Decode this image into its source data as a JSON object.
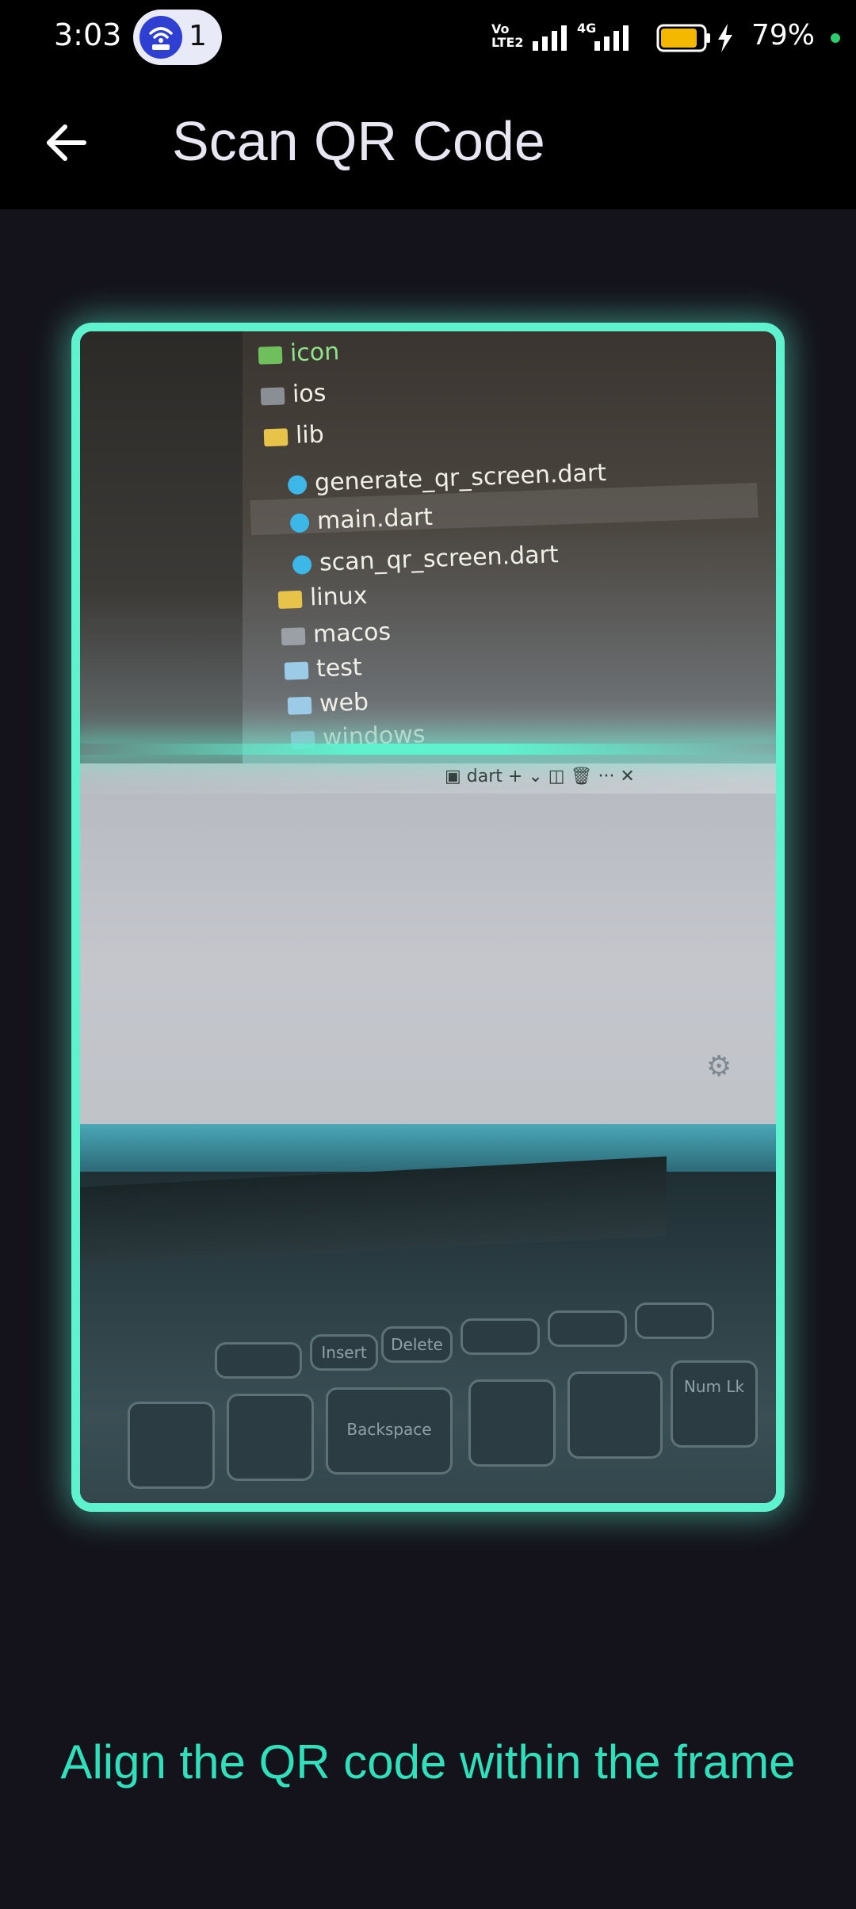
{
  "status_bar": {
    "time": "3:03",
    "notification_count": "1",
    "network_label_top": "Vo",
    "network_label_bottom": "LTE2",
    "network_4g": "4G",
    "battery_percent": "79%"
  },
  "app_bar": {
    "title": "Scan QR Code",
    "back_icon": "arrow-left-icon"
  },
  "camera_preview": {
    "file_tree": [
      "icon",
      "ios",
      "lib",
      "generate_qr_screen.dart",
      "main.dart",
      "scan_qr_screen.dart",
      "linux",
      "macos",
      "test",
      "web",
      "windows"
    ],
    "terminal_label": "dart",
    "key_labels": [
      "Backspace",
      "Num Lk",
      "Delete",
      "Insert"
    ]
  },
  "scanner": {
    "frame_color": "#5ef2cf",
    "instruction": "Align the QR code within the frame"
  }
}
